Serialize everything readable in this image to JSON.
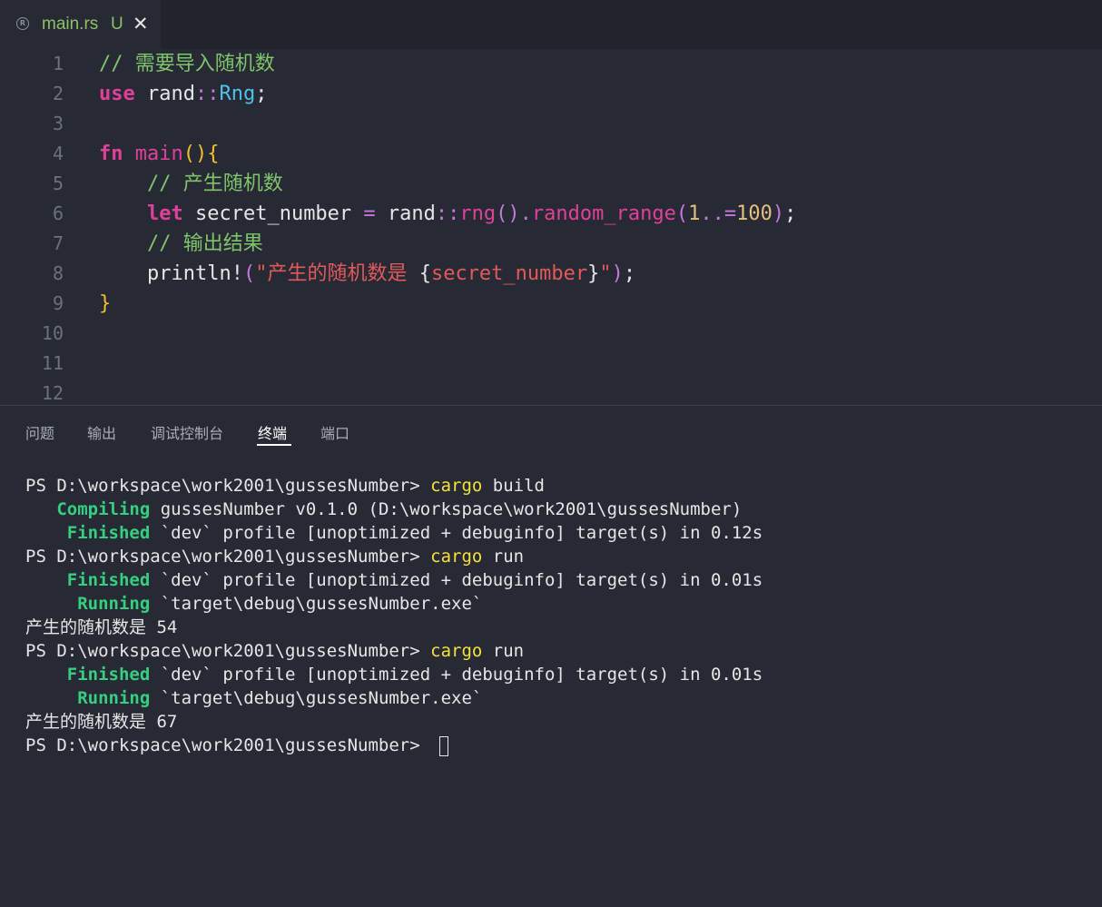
{
  "tab": {
    "icon": "rust-icon",
    "filename": "main.rs",
    "status": "U",
    "close": "✕"
  },
  "editor": {
    "line_numbers": [
      "1",
      "2",
      "3",
      "4",
      "5",
      "6",
      "7",
      "8",
      "9",
      "10",
      "11",
      "12"
    ],
    "l1": {
      "comment": "// 需要导入随机数"
    },
    "l2": {
      "kw": "use",
      "path": "rand",
      "sep": "::",
      "type": "Rng",
      "end": ";"
    },
    "l4": {
      "kw": "fn",
      "name": "main",
      "parens": "()",
      "brace": "{"
    },
    "l5": {
      "comment": "// 产生随机数"
    },
    "l6": {
      "kw": "let",
      "var": "secret_number",
      "eq": "=",
      "path": "rand",
      "sep": "::",
      "fn1": "rng",
      "p1": "()",
      "dot": ".",
      "fn2": "random_range",
      "po": "(",
      "n1": "1",
      "range": "..=",
      "n2": "100",
      "pc": ")",
      "end": ";"
    },
    "l7": {
      "comment": "// 输出结果"
    },
    "l8": {
      "macro": "println!",
      "po": "(",
      "q1": "\"",
      "text": "产生的随机数是 ",
      "bo": "{",
      "var": "secret_number",
      "bc": "}",
      "q2": "\"",
      "pc": ")",
      "end": ";"
    },
    "l9": {
      "brace": "}"
    }
  },
  "panel": {
    "tabs": [
      "问题",
      "输出",
      "调试控制台",
      "终端",
      "端口"
    ],
    "active_tab": "终端"
  },
  "terminal": {
    "prompt": "PS D:\\workspace\\work2001\\gussesNumber> ",
    "cmd1": {
      "cmd": "cargo",
      "arg": " build"
    },
    "compiling": {
      "label": "Compiling",
      "text": " gussesNumber v0.1.0 (D:\\workspace\\work2001\\gussesNumber)"
    },
    "finished1": {
      "label": "Finished",
      "text": " `dev` profile [unoptimized + debuginfo] target(s) in 0.12s"
    },
    "cmd2": {
      "cmd": "cargo",
      "arg": " run"
    },
    "finished2": {
      "label": "Finished",
      "text": " `dev` profile [unoptimized + debuginfo] target(s) in 0.01s"
    },
    "running1": {
      "label": "Running",
      "text": " `target\\debug\\gussesNumber.exe`"
    },
    "output1": "产生的随机数是 54",
    "cmd3": {
      "cmd": "cargo",
      "arg": " run"
    },
    "finished3": {
      "label": "Finished",
      "text": " `dev` profile [unoptimized + debuginfo] target(s) in 0.01s"
    },
    "running2": {
      "label": "Running",
      "text": " `target\\debug\\gussesNumber.exe`"
    },
    "output2": "产生的随机数是 67"
  },
  "colors": {
    "background": "#272a35",
    "comment": "#7ec46a",
    "keyword": "#e0409a",
    "type": "#4fc1e9",
    "string": "#e05a5a",
    "number": "#e5c07b",
    "command": "#f4e23a",
    "cargo_status": "#35d07f"
  }
}
